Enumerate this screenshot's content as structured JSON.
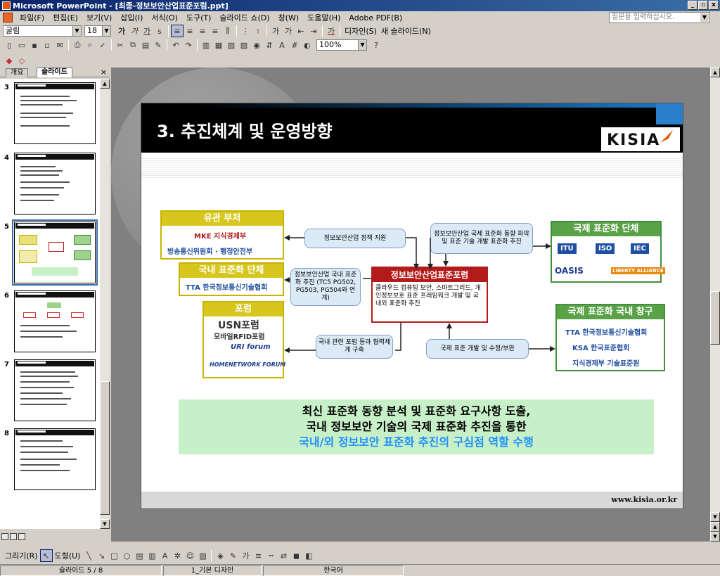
{
  "window": {
    "title": "Microsoft PowerPoint - [최종-정보보안산업표준포럼.ppt]",
    "minimize": "_",
    "restore": "▫",
    "close": "x"
  },
  "menu": {
    "items": [
      "파일(F)",
      "편집(E)",
      "보기(V)",
      "삽입(I)",
      "서식(O)",
      "도구(T)",
      "슬라이드 쇼(D)",
      "창(W)",
      "도움말(H)",
      "Adobe PDF(B)"
    ],
    "help_placeholder": "질문을 입력하십시오."
  },
  "toolbar": {
    "font": "굴림",
    "font_size": "18",
    "design_label": "디자인(S)",
    "new_slide_label": "새 슬라이드(N)",
    "zoom": "100%"
  },
  "outline_panel": {
    "tab_outline": "개요",
    "tab_slides": "슬라이드",
    "close": "×",
    "thumbnails": [
      {
        "number": "3",
        "selected": false
      },
      {
        "number": "4",
        "selected": false
      },
      {
        "number": "5",
        "selected": true
      },
      {
        "number": "6",
        "selected": false
      },
      {
        "number": "7",
        "selected": false
      },
      {
        "number": "8",
        "selected": false
      }
    ]
  },
  "slide": {
    "title": "3. 추진체계 및 운영방향",
    "logo": "KISIA",
    "footer_url": "www.kisia.or.kr",
    "boxes": {
      "agency": {
        "title": "유관 부처",
        "logo1": "MKE 지식경제부",
        "logo2": "방송통신위원회 · 행정안전부"
      },
      "domestic_std": {
        "title": "국내 표준화 단체",
        "logo": "TTA 한국정보통신기술협회"
      },
      "forum": {
        "title": "포럼",
        "logo1": "USN포럼",
        "logo2": "모바일RFID포럼",
        "logo3": "URI forum",
        "logo4": "HOMENETWORK FORUM"
      },
      "center": {
        "title": "정보보안산업표준포럼",
        "body": "클라우드 컴퓨팅 보안, 스마트그리드, 개인정보보호 표준 프레임워크 개발 및 국내외 표준화 추진"
      },
      "intl_std": {
        "title": "국제 표준화 단체",
        "logos": [
          "ITU",
          "ISO",
          "IEC",
          "OASIS",
          "LIBERTY ALLIANCE"
        ]
      },
      "intl_domestic": {
        "title": "국제 표준화 국내 창구",
        "logo1": "TTA 한국정보통신기술협회",
        "logo2": "KSA 한국표준협회",
        "logo3": "지식경제부 기술표준원"
      }
    },
    "bubbles": {
      "policy": "정보보안산업 정책 지원",
      "domestic": "정보보안산업 국내 표준화 추진 (TC5 PG502, PG503, PG504와 연계)",
      "trend": "정보보안산업 국제 표준화 동향 파악 및 표준 기술 개발 표준화 추진",
      "forum_link": "국내 관련 포럼 등과 협력체계 구축",
      "intl_dev": "국제 표준 개발 및 수정/보완"
    },
    "summary": {
      "line1": "최신 표준화 동향 분석 및 표준화 요구사항 도출,",
      "line2": "국내 정보보안 기술의 국제 표준화 추진을 통한",
      "line3": "국내/외 정보보안 표준화 추진의 구심점 역할 수행"
    }
  },
  "drawing": {
    "draw_label": "그리기(R)",
    "shapes_label": "도형(U)"
  },
  "status": {
    "slide": "슬라이드 5 / 8",
    "design": "1_기본 디자인",
    "language": "한국어"
  },
  "colors": {
    "title_bar": "#0a246a",
    "forum_red": "#b31b1b",
    "intl_green": "#5aa246",
    "domestic_yellow": "#d7c71d",
    "summary_blue": "#1e90ff"
  }
}
